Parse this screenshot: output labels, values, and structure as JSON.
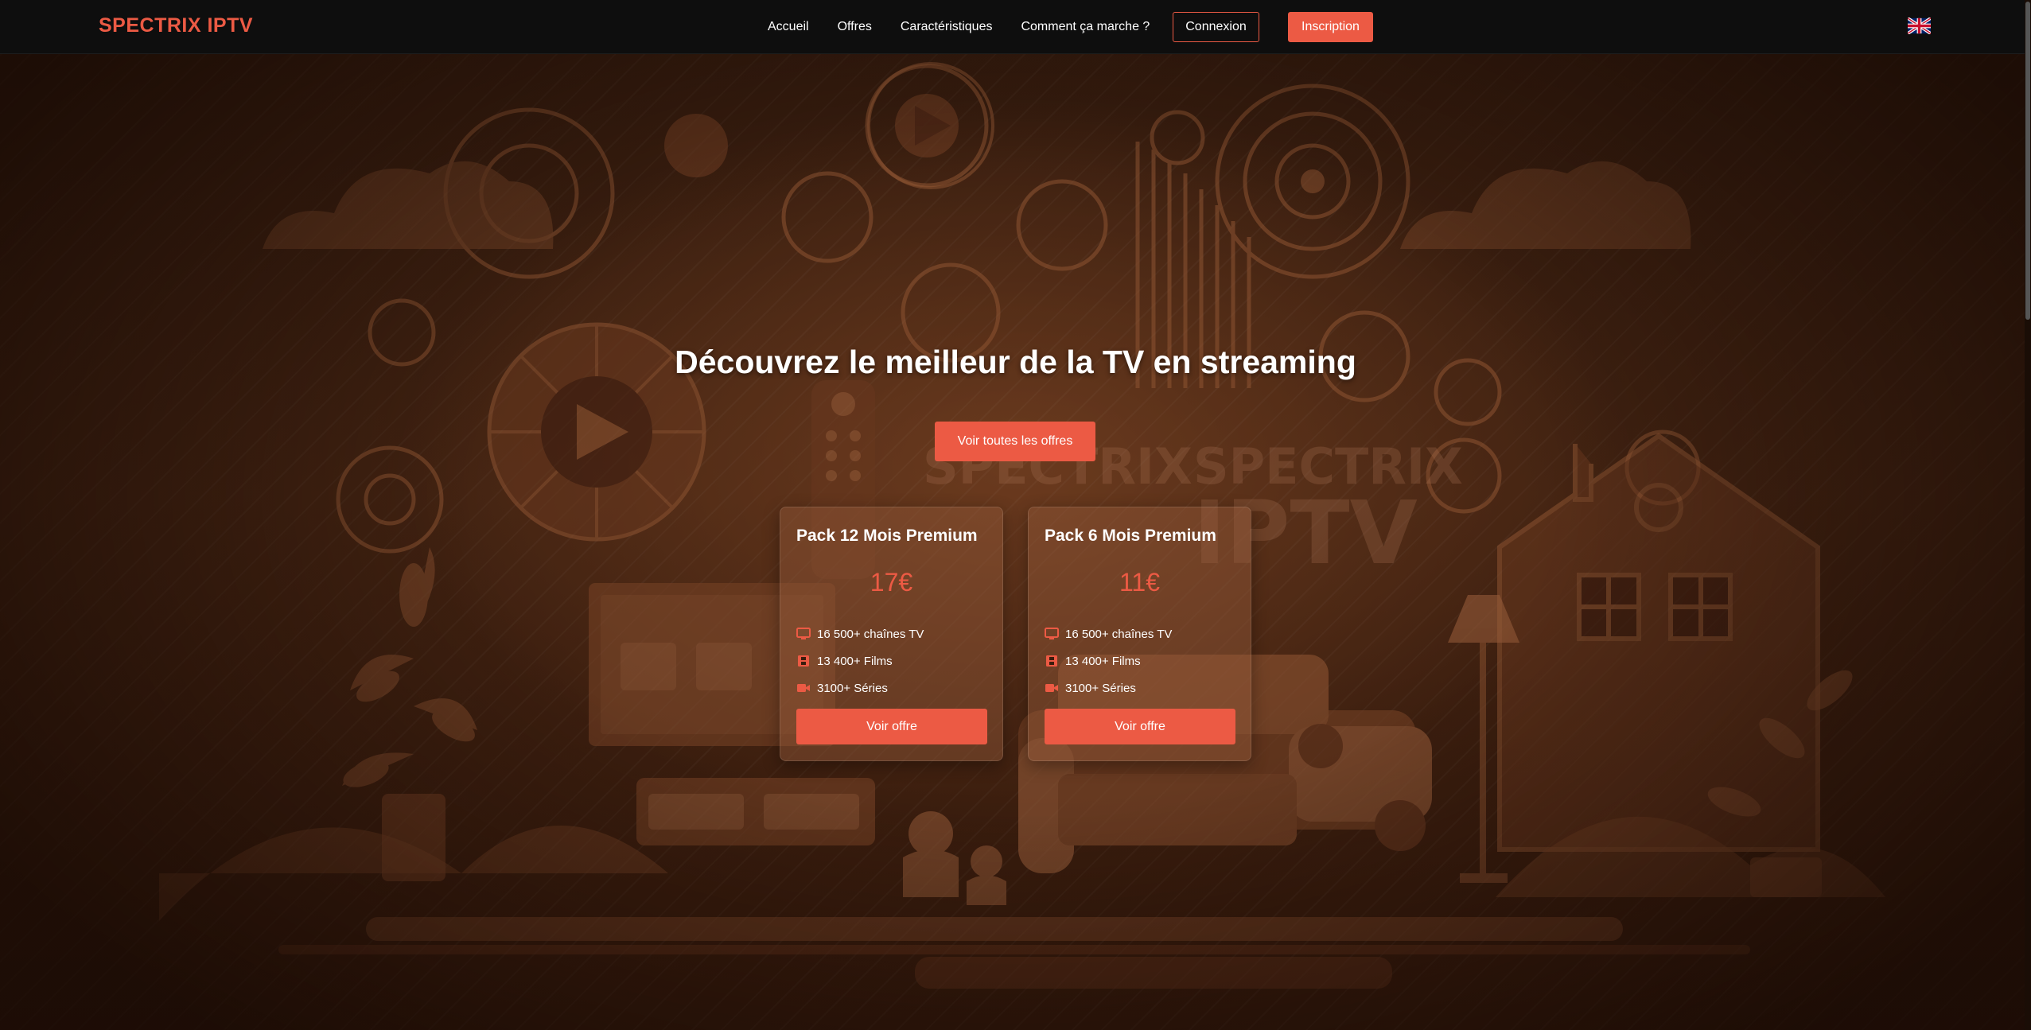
{
  "brand": "SPECTRIX IPTV",
  "nav": {
    "links": [
      "Accueil",
      "Offres",
      "Caractéristiques",
      "Comment ça marche ?"
    ],
    "login": "Connexion",
    "signup": "Inscription",
    "language_icon": "uk-flag-icon"
  },
  "hero": {
    "title": "Découvrez le meilleur de la TV en streaming",
    "cta": "Voir toutes les offres"
  },
  "offers": [
    {
      "title": "Pack 12 Mois Premium",
      "price": "17€",
      "features": [
        {
          "icon": "tv-icon",
          "text": "16 500+  chaînes TV"
        },
        {
          "icon": "film-icon",
          "text": "13 400+  Films"
        },
        {
          "icon": "video-camera-icon",
          "text": "3100+  Séries"
        }
      ],
      "button": "Voir offre"
    },
    {
      "title": "Pack 6 Mois Premium",
      "price": "11€",
      "features": [
        {
          "icon": "tv-icon",
          "text": "16 500+  chaînes TV"
        },
        {
          "icon": "film-icon",
          "text": "13 400+  Films"
        },
        {
          "icon": "video-camera-icon",
          "text": "3100+  Séries"
        }
      ],
      "button": "Voir offre"
    }
  ],
  "colors": {
    "accent": "#ec5a44",
    "navbar": "#0e0e0e",
    "background": "#3b1f10"
  }
}
